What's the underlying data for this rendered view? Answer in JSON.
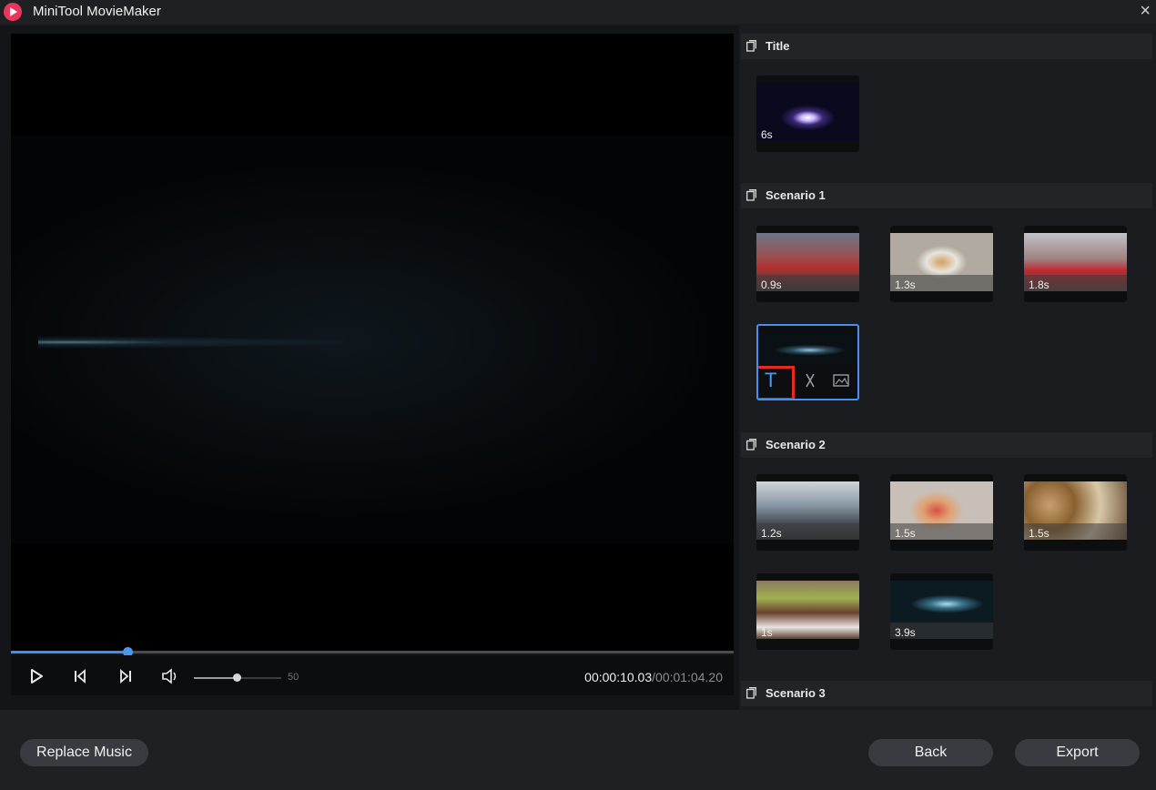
{
  "app": {
    "title": "MiniTool MovieMaker",
    "close_glyph": "×"
  },
  "player": {
    "progress_fraction": 0.16,
    "volume_value": "50",
    "volume_fraction": 0.5,
    "time_current": "00:00:10.03",
    "time_total": "/00:01:04.20",
    "icons": [
      "play-icon",
      "previous-frame-icon",
      "next-frame-icon",
      "volume-icon"
    ]
  },
  "sections": [
    {
      "title": "Title",
      "clips": [
        {
          "duration": "6s",
          "kind": "starburst"
        }
      ]
    },
    {
      "title": "Scenario 1",
      "clips": [
        {
          "duration": "0.9s",
          "kind": "crowd"
        },
        {
          "duration": "1.3s",
          "kind": "plate"
        },
        {
          "duration": "1.8s",
          "kind": "hall"
        },
        {
          "duration": "",
          "kind": "flare",
          "selected": true,
          "tools": [
            "text-icon",
            "cut-icon",
            "image-icon"
          ]
        }
      ]
    },
    {
      "title": "Scenario 2",
      "clips": [
        {
          "duration": "1.2s",
          "kind": "station"
        },
        {
          "duration": "1.5s",
          "kind": "pizza"
        },
        {
          "duration": "1.5s",
          "kind": "buffet"
        },
        {
          "duration": "1s",
          "kind": "bowls"
        },
        {
          "duration": "3.9s",
          "kind": "flare"
        }
      ]
    },
    {
      "title": "Scenario 3",
      "clips": []
    }
  ],
  "buttons": {
    "replace_music": "Replace Music",
    "back": "Back",
    "export": "Export"
  },
  "colors": {
    "accent": "#3d8fe8",
    "highlight": "#e62b1e",
    "background": "#1b1c20"
  }
}
